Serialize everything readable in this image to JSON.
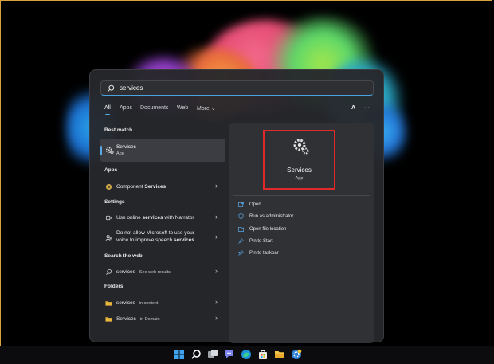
{
  "search": {
    "query": "services"
  },
  "filters": {
    "tabs": [
      "All",
      "Apps",
      "Documents",
      "Web",
      "More ⌄"
    ],
    "account": "A",
    "more_dots": "···"
  },
  "sections": {
    "best_match": "Best match",
    "apps": "Apps",
    "settings": "Settings",
    "search_web": "Search the web",
    "folders": "Folders"
  },
  "best_match": {
    "name": "Services",
    "type": "App"
  },
  "apps": [
    {
      "prefix": "Component ",
      "bold": "Services"
    }
  ],
  "settings": [
    {
      "pre": "Use online ",
      "bold": "services",
      "post": " with Narrator"
    },
    {
      "line1": "Do not allow Microsoft to use your",
      "line2_pre": "voice to improve speech ",
      "line2_bold": "services"
    }
  ],
  "web": {
    "term": "services",
    "suffix": " - See web results"
  },
  "folders": [
    {
      "name": "services",
      "location": " - in context"
    },
    {
      "name": "Services",
      "location": " - in Domain"
    }
  ],
  "preview": {
    "name": "Services",
    "type": "App",
    "actions": [
      "Open",
      "Run as administrator",
      "Open file location",
      "Pin to Start",
      "Pin to taskbar"
    ]
  },
  "taskbar": {
    "icons": [
      "windows-start-icon",
      "search-icon",
      "task-view-icon",
      "teams-chat-icon",
      "edge-icon",
      "store-icon",
      "file-explorer-icon",
      "settings-icon"
    ]
  },
  "colors": {
    "accent": "#5aa7e6",
    "highlight_box": "#e0292b",
    "frame": "#d9a23a"
  }
}
